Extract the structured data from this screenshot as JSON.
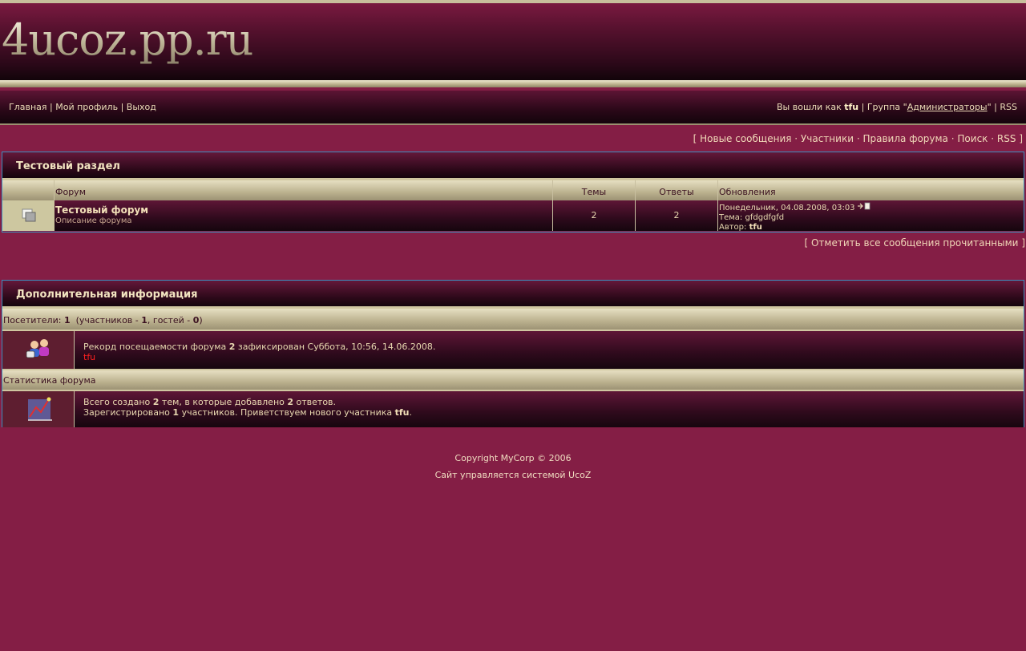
{
  "site": {
    "logo_text": "4ucoz.pp.ru"
  },
  "nav": {
    "home": "Главная",
    "profile": "Мой профиль",
    "logout": "Выход",
    "sep": "|",
    "logged_prefix": "Вы вошли как",
    "username": "tfu",
    "group_prefix": "Группа \"",
    "group_name": "Администраторы",
    "group_suffix": "\"",
    "rss": "RSS"
  },
  "quick_links": {
    "open_bracket": "[",
    "close_bracket": "]",
    "dot": "·",
    "new_messages": "Новые сообщения",
    "members": "Участники",
    "rules": "Правила форума",
    "search": "Поиск",
    "rss": "RSS"
  },
  "section": {
    "title": "Тестовый раздел",
    "columns": {
      "forum": "Форум",
      "topics": "Темы",
      "replies": "Ответы",
      "updates": "Обновления"
    },
    "forums": [
      {
        "name": "Тестовый форум",
        "description": "Описание форума",
        "topics": "2",
        "replies": "2",
        "last_date": "Понедельник, 04.08.2008, 03:03",
        "topic_prefix": "Тема:",
        "topic_name": "gfdgdfgfd",
        "author_prefix": "Автор:",
        "author_name": "tfu"
      }
    ],
    "mark_all_read": "Отметить все сообщения прочитанными"
  },
  "extra": {
    "title": "Дополнительная информация",
    "visitors_label": "Посетители:",
    "visitors_total": "1",
    "members_label": "(участников -",
    "members_count": "1",
    "guests_label": ", гостей -",
    "guests_count": "0",
    "close_paren": ")",
    "record_prefix": "Рекорд посещаемости форума",
    "record_count": "2",
    "record_suffix": "зафиксирован Суббота, 10:56, 14.06.2008.",
    "online_user": "tfu",
    "stats_title": "Статистика форума",
    "stats_line1_prefix": "Всего создано",
    "stats_topics": "2",
    "stats_line1_mid": "тем, в которые добавлено",
    "stats_replies": "2",
    "stats_line1_suffix": "ответов.",
    "stats_line2_prefix": "Зарегистрировано",
    "stats_members": "1",
    "stats_line2_mid": "участников. Приветствуем нового участника",
    "stats_newest": "tfu",
    "stats_line2_suffix": "."
  },
  "footer": {
    "copyright": "Copyright MyCorp © 2006",
    "powered": "Сайт управляется системой UcoZ"
  },
  "colors": {
    "background": "#841e45",
    "gold": "#bbb18e",
    "border_blue": "#3b8fbf",
    "online_user_red": "#ff2020"
  }
}
